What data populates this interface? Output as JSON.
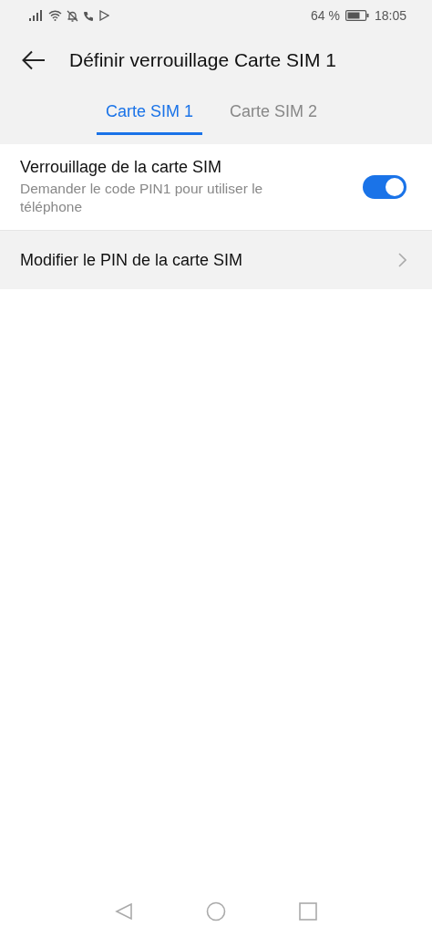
{
  "status_bar": {
    "battery": "64 %",
    "time": "18:05"
  },
  "header": {
    "title": "Définir verrouillage Carte SIM 1"
  },
  "tabs": [
    {
      "label": "Carte SIM 1",
      "selected": true
    },
    {
      "label": "Carte SIM 2",
      "selected": false
    }
  ],
  "settings": [
    {
      "kind": "toggle",
      "title": "Verrouillage de la carte SIM",
      "subtitle": "Demander le code PIN1 pour utiliser le téléphone",
      "on": true
    },
    {
      "kind": "link",
      "title": "Modifier le PIN de la carte SIM"
    }
  ]
}
